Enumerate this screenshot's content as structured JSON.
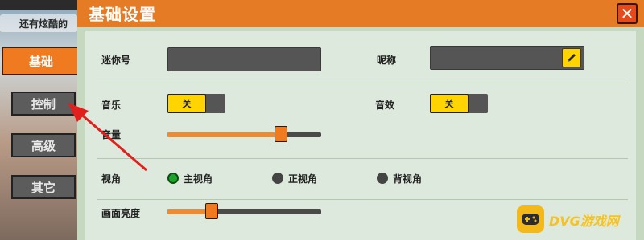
{
  "background": {
    "note_text": "还有炫酷的"
  },
  "sidebar": {
    "items": [
      {
        "label": "基础",
        "active": true
      },
      {
        "label": "控制",
        "active": false
      },
      {
        "label": "高级",
        "active": false
      },
      {
        "label": "其它",
        "active": false
      }
    ]
  },
  "panel": {
    "title": "基础设置",
    "close_symbol": "✕"
  },
  "settings": {
    "mini_id_label": "迷你号",
    "mini_id_value": "",
    "nickname_label": "昵称",
    "nickname_value": "",
    "edit_icon": "pencil-icon",
    "music_label": "音乐",
    "music_toggle": "关",
    "sfx_label": "音效",
    "sfx_toggle": "关",
    "volume_label": "音量",
    "volume_level": 0.74,
    "view_label": "视角",
    "view_options": [
      {
        "label": "主视角",
        "selected": true
      },
      {
        "label": "正视角",
        "selected": false
      },
      {
        "label": "背视角",
        "selected": false
      }
    ],
    "brightness_label": "画面亮度",
    "brightness_level": 0.29
  },
  "watermark": {
    "text": "DVG游戏网"
  },
  "colors": {
    "accent_orange": "#f07a1f",
    "toggle_yellow": "#ffd400",
    "radio_green": "#1da32b",
    "panel_bg": "#dde9dc"
  }
}
